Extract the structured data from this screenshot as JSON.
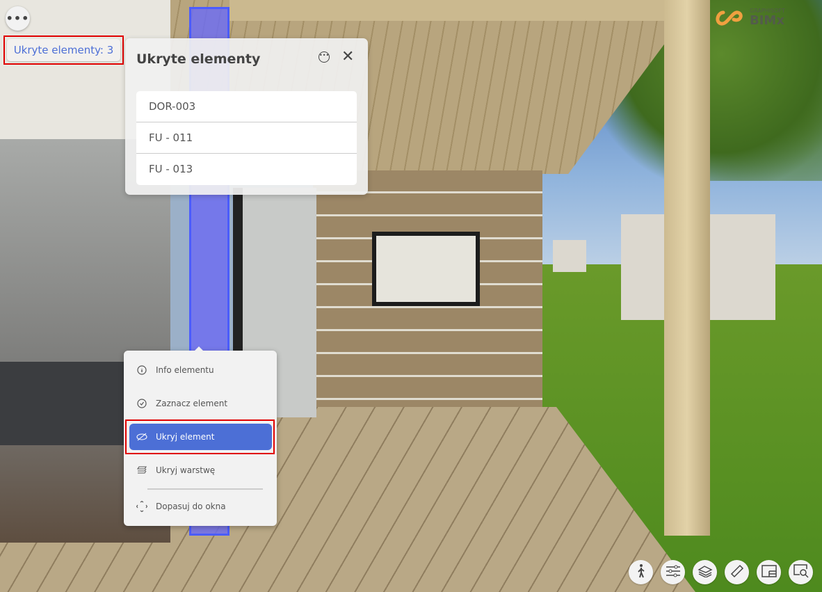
{
  "toolbar_top": {
    "more_label": "•••"
  },
  "hidden_chip": {
    "label": "Ukryte elementy: 3"
  },
  "hidden_panel": {
    "title": "Ukryte elementy",
    "close_label": "✕",
    "items": [
      "DOR-003",
      "FU - 011",
      "FU - 013"
    ]
  },
  "context_menu": {
    "items": [
      {
        "label": "Info elementu",
        "icon": "info-icon"
      },
      {
        "label": "Zaznacz element",
        "icon": "check-circle-icon"
      },
      {
        "label": "Ukryj element",
        "icon": "eye-off-icon",
        "active": true
      },
      {
        "label": "Ukryj warstwę",
        "icon": "layers-icon"
      },
      {
        "label": "Dopasuj do okna",
        "icon": "fit-window-icon"
      }
    ]
  },
  "logo": {
    "brand": "GRAPHISOFT",
    "product": "BIMx"
  },
  "bottom_toolbar": [
    "walk-icon",
    "settings-sliders-icon",
    "layers-icon",
    "ruler-icon",
    "view-icon",
    "zoom-search-icon"
  ],
  "colors": {
    "accent": "#4c6fd6",
    "highlight": "#e00000"
  }
}
